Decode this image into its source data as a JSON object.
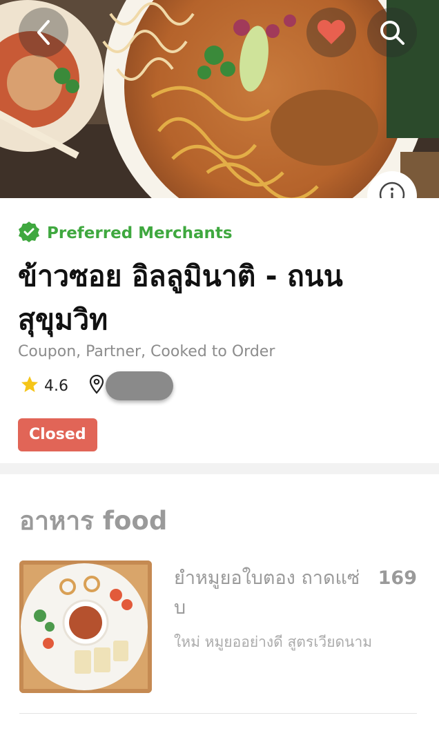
{
  "header": {
    "icons": {
      "back": "chevron-left-icon",
      "favorite": "heart-icon",
      "search": "search-icon",
      "info": "info-icon"
    },
    "favorite_color": "#e8604f"
  },
  "merchant": {
    "preferred_label": "Preferred Merchants",
    "preferred_color": "#3fa83f",
    "name": "ข้าวซอย อิลลูมินาติ - ถนนสุขุมวิท",
    "tags": "Coupon, Partner, Cooked to Order",
    "rating": "4.6",
    "status": "Closed",
    "status_color": "#e16557"
  },
  "menu": {
    "section_title": "อาหาร food",
    "items": [
      {
        "name": "ยำหมูยอใบตอง ถาดแซ่บ",
        "price": "169",
        "description": "ใหม่ หมูยออย่างดี สูตรเวียดนาม"
      }
    ]
  }
}
